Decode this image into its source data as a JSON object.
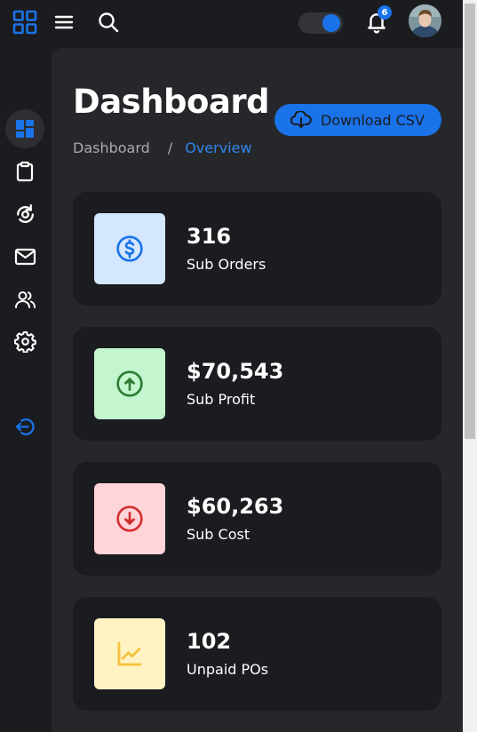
{
  "header": {
    "notification_count": "6",
    "theme_toggle_on": true,
    "icons": [
      "apps-grid-icon",
      "hamburger-menu-icon",
      "search-icon",
      "bell-icon"
    ]
  },
  "sidebar": {
    "items": [
      {
        "icon": "dashboard-icon",
        "active": true
      },
      {
        "icon": "clipboard-icon",
        "active": false
      },
      {
        "icon": "chart-refresh-icon",
        "active": false
      },
      {
        "icon": "mail-icon",
        "active": false
      },
      {
        "icon": "users-icon",
        "active": false
      },
      {
        "icon": "gear-icon",
        "active": false
      },
      {
        "icon": "logout-icon",
        "active": false
      }
    ]
  },
  "page": {
    "title": "Dashboard",
    "breadcrumb": [
      "Dashboard",
      "/",
      "Overview"
    ],
    "download_label": "Download CSV"
  },
  "cards": [
    {
      "value": "316",
      "label": "Sub Orders",
      "icon": "dollar-circle-icon",
      "bg": "#d4e7ff",
      "color": "#1a73e8"
    },
    {
      "value": "$70,543",
      "label": "Sub Profit",
      "icon": "arrow-up-circle-icon",
      "bg": "#c3f5cf",
      "color": "#2e7d32"
    },
    {
      "value": "$60,263",
      "label": "Sub Cost",
      "icon": "arrow-down-circle-icon",
      "bg": "#ffd5d9",
      "color": "#d32f2f"
    },
    {
      "value": "102",
      "label": "Unpaid POs",
      "icon": "trend-chart-icon",
      "bg": "#fff3c4",
      "color": "#f5c342"
    }
  ],
  "colors": {
    "accent": "#1a73e8",
    "background": "#1e1f23",
    "card": "#1b1c20"
  }
}
